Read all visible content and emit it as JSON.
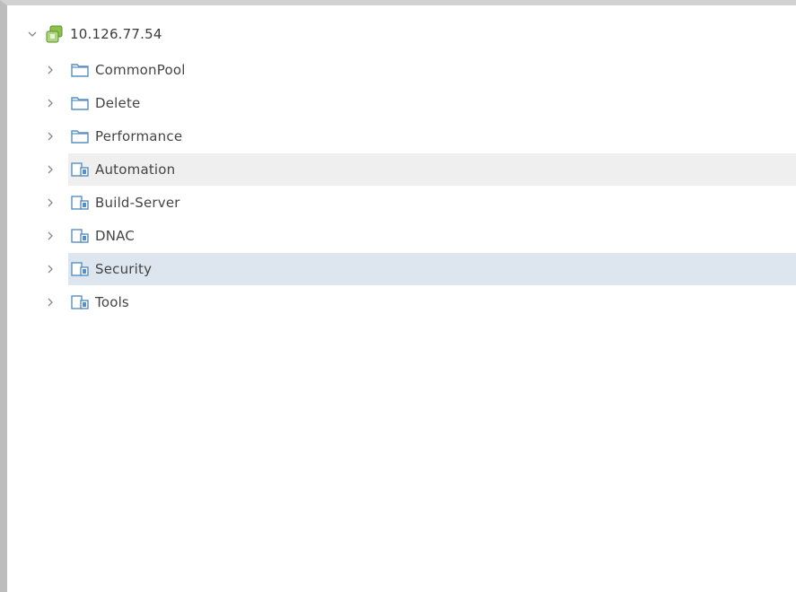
{
  "tree": {
    "root": {
      "label": "10.126.77.54",
      "icon": "vcenter-host-icon",
      "expanded": true
    },
    "items": [
      {
        "label": "CommonPool",
        "icon": "folder-icon",
        "state": "normal"
      },
      {
        "label": "Delete",
        "icon": "folder-icon",
        "state": "normal"
      },
      {
        "label": "Performance",
        "icon": "folder-icon",
        "state": "normal"
      },
      {
        "label": "Automation",
        "icon": "datacenter-icon",
        "state": "hover"
      },
      {
        "label": "Build-Server",
        "icon": "datacenter-icon",
        "state": "normal"
      },
      {
        "label": "DNAC",
        "icon": "datacenter-icon",
        "state": "normal"
      },
      {
        "label": "Security",
        "icon": "datacenter-icon",
        "state": "selected"
      },
      {
        "label": "Tools",
        "icon": "datacenter-icon",
        "state": "normal"
      }
    ]
  },
  "colors": {
    "root_icon": "#7cb342",
    "folder_icon": "#5a8fbf",
    "datacenter_icon": "#5a8fbf",
    "hover_bg": "#efefef",
    "selected_bg": "#dde6ee"
  }
}
